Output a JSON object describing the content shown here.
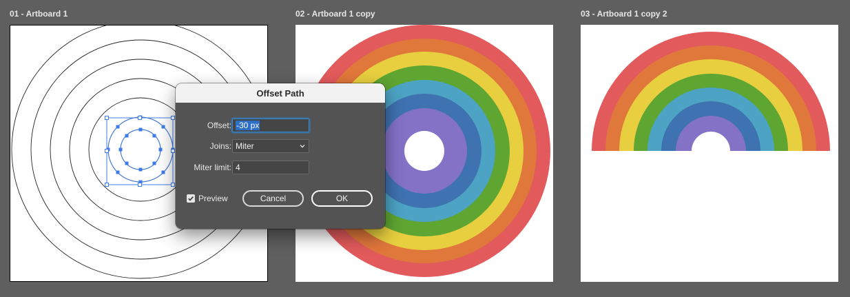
{
  "artboards": [
    {
      "label": "01 - Artboard 1"
    },
    {
      "label": "02 - Artboard 1 copy"
    },
    {
      "label": "03 - Artboard 1 copy 2"
    }
  ],
  "rainbow_colors": [
    "#e25a5c",
    "#e0773b",
    "#e7cf3f",
    "#5ea532",
    "#4ca3c4",
    "#3f72b0",
    "#8372c6"
  ],
  "selection_color": "#3d7be8",
  "dialog": {
    "title": "Offset Path",
    "offset_label": "Offset:",
    "offset_value": "-30 px",
    "joins_label": "Joins:",
    "joins_value": "Miter",
    "miter_label": "Miter limit:",
    "miter_value": "4",
    "preview_label": "Preview",
    "preview_checked": true,
    "cancel_label": "Cancel",
    "ok_label": "OK"
  }
}
